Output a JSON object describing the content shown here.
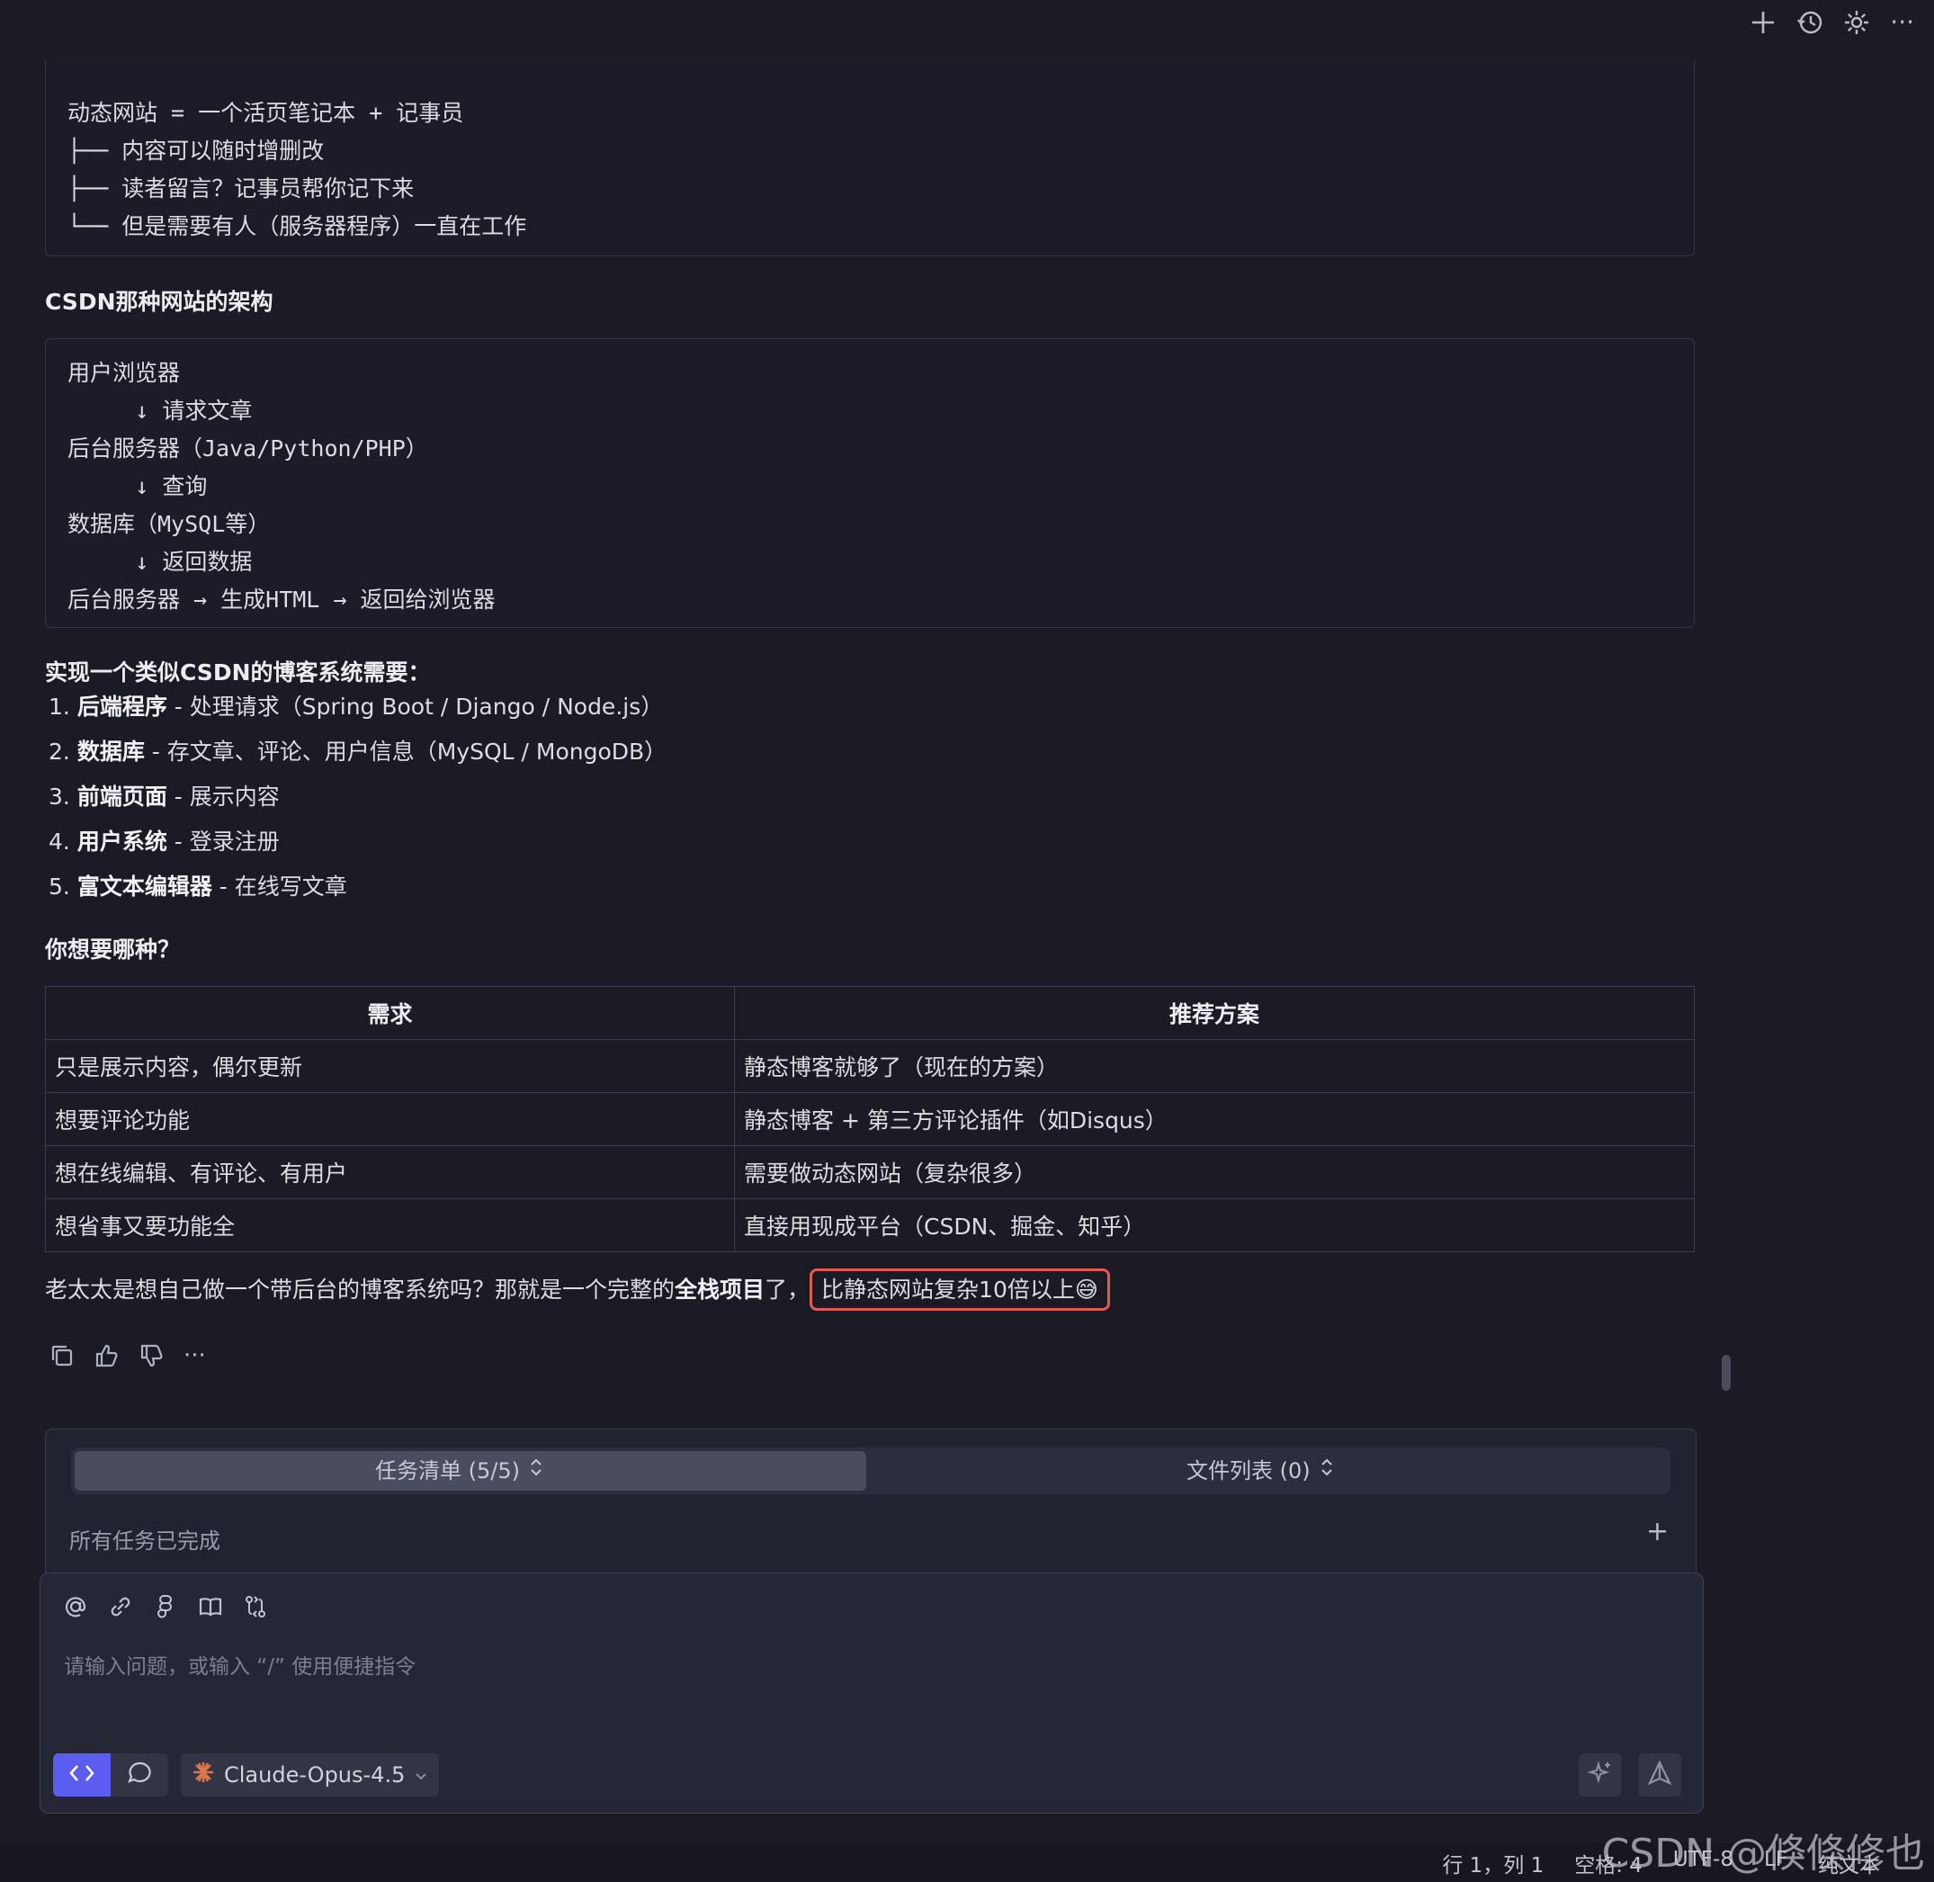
{
  "dynamic_block": {
    "lines": [
      "动态网站 = 一个活页笔记本 + 记事员",
      "├── 内容可以随时增删改",
      "├── 读者留言？记事员帮你记下来",
      "└── 但是需要有人（服务器程序）一直在工作"
    ]
  },
  "csdn_heading": "CSDN那种网站的架构",
  "arch_block": {
    "lines": [
      "用户浏览器",
      "     ↓ 请求文章",
      "后台服务器（Java/Python/PHP）",
      "     ↓ 查询",
      "数据库（MySQL等）",
      "     ↓ 返回数据",
      "后台服务器 → 生成HTML → 返回给浏览器"
    ]
  },
  "requirements_heading": "实现一个类似CSDN的博客系统需要：",
  "requirements": [
    {
      "num": "1.",
      "title": "后端程序",
      "desc": " - 处理请求（Spring Boot / Django / Node.js）"
    },
    {
      "num": "2.",
      "title": "数据库",
      "desc": " - 存文章、评论、用户信息（MySQL / MongoDB）"
    },
    {
      "num": "3.",
      "title": "前端页面",
      "desc": " - 展示内容"
    },
    {
      "num": "4.",
      "title": "用户系统",
      "desc": " - 登录注册"
    },
    {
      "num": "5.",
      "title": "富文本编辑器",
      "desc": " - 在线写文章"
    }
  ],
  "question_heading": "你想要哪种？",
  "table": {
    "headers": [
      "需求",
      "推荐方案"
    ],
    "rows": [
      [
        "只是展示内容，偶尔更新",
        "静态博客就够了（现在的方案）"
      ],
      [
        "想要评论功能",
        "静态博客 + 第三方评论插件（如Disqus）"
      ],
      [
        "想在线编辑、有评论、有用户",
        "需要做动态网站（复杂很多）"
      ],
      [
        "想省事又要功能全",
        "直接用现成平台（CSDN、掘金、知乎）"
      ]
    ]
  },
  "conclusion": {
    "prefix": "老太太是想自己做一个带后台的博客系统吗？那就是一个完整的",
    "bold": "全栈项目",
    "suffix": "了，",
    "highlight": "比静态网站复杂10倍以上😅"
  },
  "actions": {
    "copy": "copy-icon",
    "like": "thumbs-up-icon",
    "dislike": "thumbs-down-icon",
    "more": "···"
  },
  "panel": {
    "tab_tasks": "任务清单 (5/5)",
    "tab_files": "文件列表 (0)",
    "status": "所有任务已完成",
    "add": "+"
  },
  "input": {
    "placeholder": "请输入问题，或输入 “/” 使用便捷指令",
    "model": "Claude-Opus-4.5"
  },
  "statusbar": {
    "position": "行 1，列 1",
    "spaces": "空格: 4",
    "encoding": "UTF-8",
    "eol": "LF",
    "language": "纯文本"
  },
  "watermark": "CSDN @倏倏修也",
  "colors": {
    "accent": "#5b5df0",
    "highlight_border": "#e25b52",
    "background": "#1b1b26"
  }
}
